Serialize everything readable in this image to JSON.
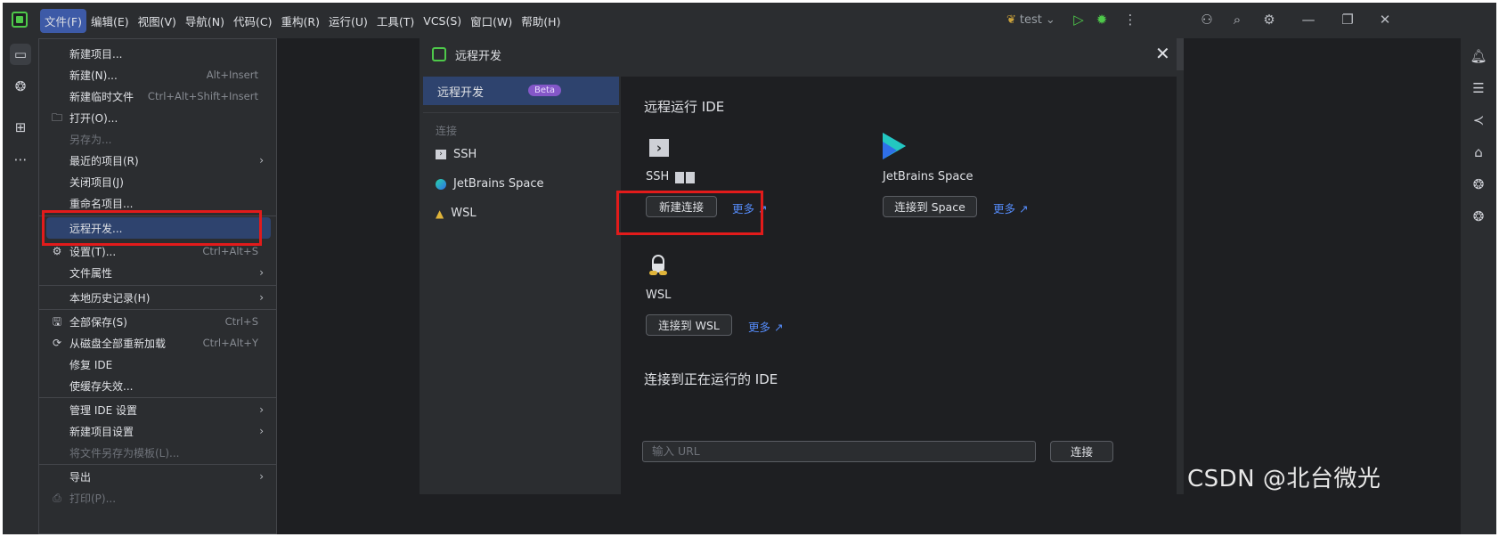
{
  "menubar": {
    "items": [
      "文件(F)",
      "编辑(E)",
      "视图(V)",
      "导航(N)",
      "代码(C)",
      "重构(R)",
      "运行(U)",
      "工具(T)",
      "VCS(S)",
      "窗口(W)",
      "帮助(H)"
    ]
  },
  "toolbar": {
    "run_config": "test",
    "run_config_chevron": "⌄"
  },
  "file_menu": {
    "items": [
      {
        "label": "新建项目...",
        "shortcut": "",
        "icon": "",
        "submenu": false,
        "disabled": false
      },
      {
        "label": "新建(N)...",
        "shortcut": "Alt+Insert",
        "icon": "",
        "submenu": false,
        "disabled": false
      },
      {
        "label": "新建临时文件",
        "shortcut": "Ctrl+Alt+Shift+Insert",
        "icon": "",
        "submenu": false,
        "disabled": false
      },
      {
        "label": "打开(O)...",
        "shortcut": "",
        "icon": "folder-icon",
        "submenu": false,
        "disabled": false
      },
      {
        "label": "另存为...",
        "shortcut": "",
        "icon": "",
        "submenu": false,
        "disabled": true
      },
      {
        "label": "最近的项目(R)",
        "shortcut": "",
        "icon": "",
        "submenu": true,
        "disabled": false
      },
      {
        "label": "关闭项目(J)",
        "shortcut": "",
        "icon": "",
        "submenu": false,
        "disabled": false
      },
      {
        "label": "重命名项目...",
        "shortcut": "",
        "icon": "",
        "submenu": false,
        "disabled": false
      },
      {
        "label": "远程开发...",
        "shortcut": "",
        "icon": "",
        "submenu": false,
        "disabled": false
      },
      {
        "label": "设置(T)...",
        "shortcut": "Ctrl+Alt+S",
        "icon": "gear-icon",
        "submenu": false,
        "disabled": false
      },
      {
        "label": "文件属性",
        "shortcut": "",
        "icon": "",
        "submenu": true,
        "disabled": false
      },
      {
        "label": "本地历史记录(H)",
        "shortcut": "",
        "icon": "",
        "submenu": true,
        "disabled": false
      },
      {
        "label": "全部保存(S)",
        "shortcut": "Ctrl+S",
        "icon": "save-icon",
        "submenu": false,
        "disabled": false
      },
      {
        "label": "从磁盘全部重新加载",
        "shortcut": "Ctrl+Alt+Y",
        "icon": "reload-icon",
        "submenu": false,
        "disabled": false
      },
      {
        "label": "修复 IDE",
        "shortcut": "",
        "icon": "",
        "submenu": false,
        "disabled": false
      },
      {
        "label": "使缓存失效...",
        "shortcut": "",
        "icon": "",
        "submenu": false,
        "disabled": false
      },
      {
        "label": "管理 IDE 设置",
        "shortcut": "",
        "icon": "",
        "submenu": true,
        "disabled": false
      },
      {
        "label": "新建项目设置",
        "shortcut": "",
        "icon": "",
        "submenu": true,
        "disabled": false
      },
      {
        "label": "将文件另存为模板(L)...",
        "shortcut": "",
        "icon": "",
        "submenu": false,
        "disabled": true
      },
      {
        "label": "导出",
        "shortcut": "",
        "icon": "",
        "submenu": true,
        "disabled": false
      },
      {
        "label": "打印(P)...",
        "shortcut": "",
        "icon": "print-icon",
        "submenu": false,
        "disabled": true
      }
    ],
    "submenu_arrow": "›"
  },
  "dialog": {
    "title": "远程开发",
    "close": "✕",
    "sidebar": {
      "selected": "远程开发",
      "beta": "Beta",
      "group": "连接",
      "items": [
        "SSH",
        "JetBrains Space",
        "WSL"
      ]
    },
    "run_ide_heading": "远程运行 IDE",
    "ssh": {
      "title": "SSH",
      "button": "新建连接",
      "more": "更多"
    },
    "space": {
      "title": "JetBrains Space",
      "button": "连接到 Space",
      "more": "更多"
    },
    "wsl": {
      "title": "WSL",
      "button": "连接到 WSL",
      "more": "更多"
    },
    "connect_running_heading": "连接到正在运行的 IDE",
    "url_placeholder": "输入 URL",
    "connect_button": "连接",
    "external_arrow": "↗"
  },
  "watermark": "CSDN @北台微光",
  "colors": {
    "accent": "#548af7",
    "highlight": "#e21b1b",
    "selection": "#2e436e",
    "beta": "#8457c8"
  }
}
